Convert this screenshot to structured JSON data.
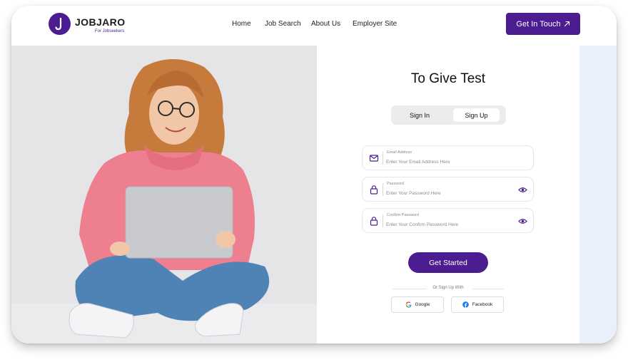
{
  "brand": {
    "name": "JOBJARO",
    "tagline": "For Jobseekers",
    "color": "#4b1d91"
  },
  "nav": {
    "items": [
      {
        "label": "Home"
      },
      {
        "label": "Job Search"
      },
      {
        "label": "About Us"
      },
      {
        "label": "Employer Site"
      }
    ]
  },
  "cta": {
    "label": "Get In Touch",
    "icon": "arrow-up-right-icon"
  },
  "hero": {
    "image": "woman-with-laptop-photo"
  },
  "form": {
    "title": "To Give Test",
    "tabs": [
      {
        "label": "Sign In",
        "active": false
      },
      {
        "label": "Sign Up",
        "active": true
      }
    ],
    "fields": [
      {
        "label": "Email Address",
        "placeholder": "Enter Your Email Address Here",
        "value": "",
        "icon": "mail-icon"
      },
      {
        "label": "Password",
        "placeholder": "Enter Your Password Here",
        "value": "",
        "icon": "lock-icon",
        "toggle_icon": "eye-icon"
      },
      {
        "label": "Confirm Password",
        "placeholder": "Enter Your Confirm Password Here",
        "value": "",
        "icon": "lock-icon",
        "toggle_icon": "eye-icon"
      }
    ],
    "submit_label": "Get Started",
    "divider_text": "Or Sign Up With",
    "social": [
      {
        "label": "Google",
        "icon": "google-icon"
      },
      {
        "label": "Facebook",
        "icon": "facebook-icon"
      }
    ]
  },
  "colors": {
    "accent": "#4b1d91",
    "side_panel": "#e9f0fa",
    "photo_bg": "#e6e6e8"
  }
}
